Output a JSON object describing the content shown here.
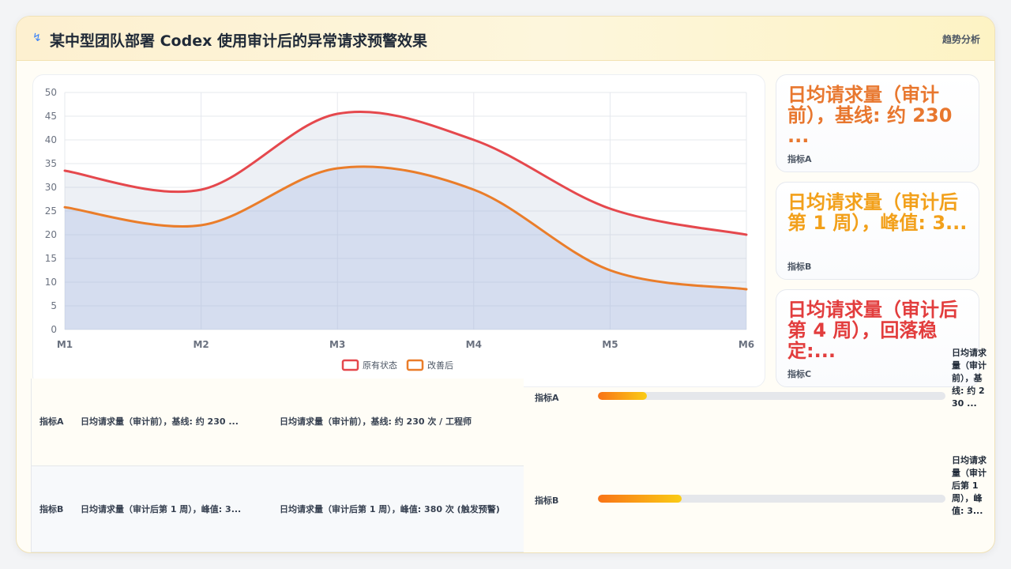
{
  "header": {
    "title": "某中型团队部署 Codex 使用审计后的异常请求预警效果",
    "tag": "趋势分析"
  },
  "chart_data": {
    "type": "area",
    "categories": [
      "M1",
      "M2",
      "M3",
      "M4",
      "M5",
      "M6"
    ],
    "series": [
      {
        "name": "原有状态",
        "color": "#e5484d",
        "values": [
          33.5,
          29.5,
          45.5,
          40,
          25.5,
          20
        ]
      },
      {
        "name": "改善后",
        "color": "#ea7d2a",
        "values": [
          25.8,
          22,
          34,
          29.5,
          12.5,
          8.5
        ]
      }
    ],
    "ylim": [
      0,
      50
    ],
    "yticks": [
      0,
      5,
      10,
      15,
      20,
      25,
      30,
      35,
      40,
      45,
      50
    ],
    "grid": true,
    "legend": "bottom"
  },
  "kpis": [
    {
      "value": "日均请求量（审计前），基线: 约 230 ...",
      "label": "指标A",
      "color": "#e8772e"
    },
    {
      "value": "日均请求量（审计后第 1 周），峰值: 3...",
      "label": "指标B",
      "color": "#f2a01a"
    },
    {
      "value": "日均请求量（审计后第 4 周），回落稳定:...",
      "label": "指标C",
      "color": "#e23d3d"
    }
  ],
  "table": [
    {
      "label": "指标A",
      "short": "日均请求量（审计前），基线: 约 230 ...",
      "full": "日均请求量（审计前），基线: 约 230 次 / 工程师"
    },
    {
      "label": "指标B",
      "short": "日均请求量（审计后第 1 周），峰值: 3...",
      "full": "日均请求量（审计后第 1 周），峰值: 380 次 (触发预警)"
    }
  ],
  "bars": [
    {
      "label": "指标A",
      "fraction": 0.14,
      "desc": "日均请求量（审计前），基线: 约 230 ..."
    },
    {
      "label": "指标B",
      "fraction": 0.24,
      "desc": "日均请求量（审计后第 1 周），峰值: 3..."
    }
  ]
}
